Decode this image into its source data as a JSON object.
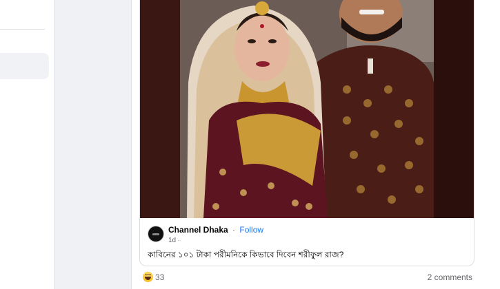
{
  "post": {
    "page_name": "Channel Dhaka",
    "separator": "·",
    "follow_label": "Follow",
    "time": "1d",
    "caption": "কাবিনের ১০১ টাকা পরীমনিকে কিভাবে দিবেন শরীফুল রাজ?",
    "reaction_count": "33",
    "comments_label": "2 comments",
    "image_description_icon": "wedding-photo"
  },
  "colors": {
    "accent": "#1877f2",
    "secondary_text": "#65676b",
    "page_bg": "#eff1f4"
  }
}
